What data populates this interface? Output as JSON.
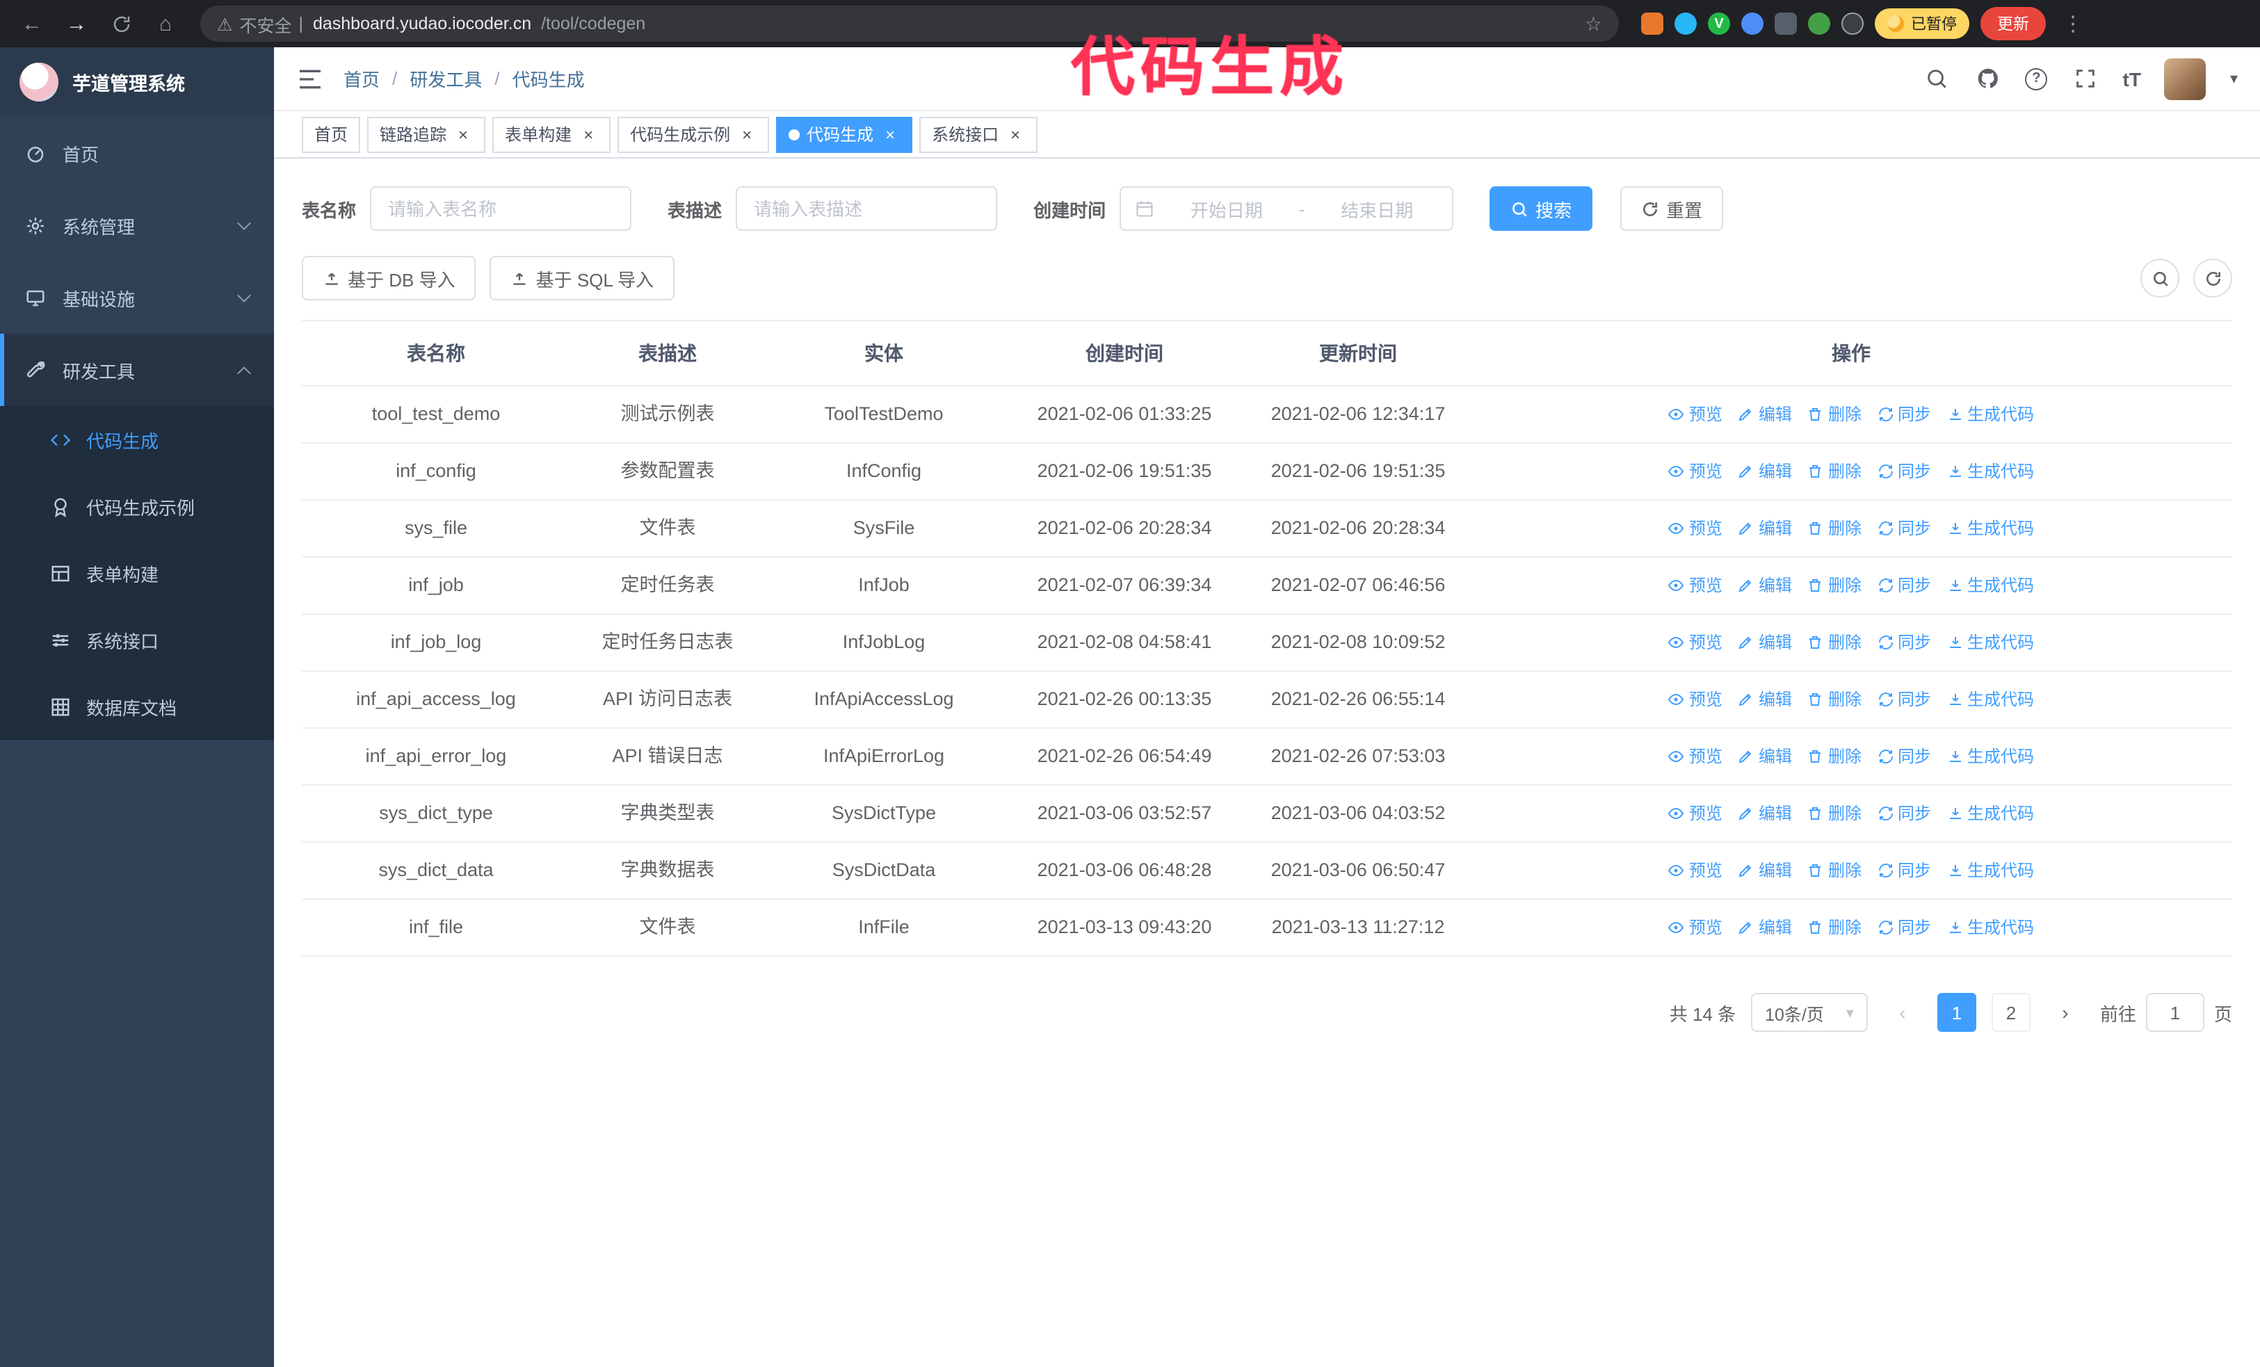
{
  "colors": {
    "primary": "#409eff",
    "sidebar_bg": "#304156",
    "submenu_bg": "#1f2d3d",
    "annotation_red": "#ff3355",
    "update_button_bg": "#e8453c",
    "paused_badge_bg": "#fdd663"
  },
  "icons": {
    "back": "←",
    "forward": "→",
    "home": "⌂",
    "star": "☆",
    "warning": "⚠",
    "divider": "|",
    "menu_dots": "⋮",
    "close": "×",
    "prev": "‹",
    "next": "›",
    "caret": "▾",
    "font_size": "tT",
    "help": "?",
    "check": "V"
  },
  "browser": {
    "security_text": "不安全",
    "url_domain": "dashboard.yudao.iocoder.cn",
    "url_path": "/tool/codegen",
    "paused_badge": "已暂停",
    "update_button": "更新"
  },
  "annotation": {
    "text": "代码生成"
  },
  "sidebar": {
    "logo_title": "芋道管理系统",
    "items": [
      {
        "label": "首页"
      },
      {
        "label": "系统管理"
      },
      {
        "label": "基础设施"
      },
      {
        "label": "研发工具"
      }
    ],
    "submenu": [
      {
        "label": "代码生成"
      },
      {
        "label": "代码生成示例"
      },
      {
        "label": "表单构建"
      },
      {
        "label": "系统接口"
      },
      {
        "label": "数据库文档"
      }
    ]
  },
  "breadcrumb": [
    "首页",
    "研发工具",
    "代码生成"
  ],
  "tabs": [
    {
      "label": "首页"
    },
    {
      "label": "链路追踪"
    },
    {
      "label": "表单构建"
    },
    {
      "label": "代码生成示例"
    },
    {
      "label": "代码生成"
    },
    {
      "label": "系统接口"
    }
  ],
  "search_form": {
    "table_name_label": "表名称",
    "table_name_placeholder": "请输入表名称",
    "table_desc_label": "表描述",
    "table_desc_placeholder": "请输入表描述",
    "create_time_label": "创建时间",
    "start_placeholder": "开始日期",
    "separator": "-",
    "end_placeholder": "结束日期",
    "search_button": "搜索",
    "reset_button": "重置"
  },
  "toolbar": {
    "import_db": "基于 DB 导入",
    "import_sql": "基于 SQL 导入"
  },
  "table": {
    "columns": [
      "表名称",
      "表描述",
      "实体",
      "创建时间",
      "更新时间",
      "操作"
    ],
    "actions": [
      "预览",
      "编辑",
      "删除",
      "同步",
      "生成代码"
    ],
    "rows": [
      {
        "name": "tool_test_demo",
        "desc": "测试示例表",
        "entity": "ToolTestDemo",
        "created": "2021-02-06 01:33:25",
        "updated": "2021-02-06 12:34:17"
      },
      {
        "name": "inf_config",
        "desc": "参数配置表",
        "entity": "InfConfig",
        "created": "2021-02-06 19:51:35",
        "updated": "2021-02-06 19:51:35"
      },
      {
        "name": "sys_file",
        "desc": "文件表",
        "entity": "SysFile",
        "created": "2021-02-06 20:28:34",
        "updated": "2021-02-06 20:28:34"
      },
      {
        "name": "inf_job",
        "desc": "定时任务表",
        "entity": "InfJob",
        "created": "2021-02-07 06:39:34",
        "updated": "2021-02-07 06:46:56"
      },
      {
        "name": "inf_job_log",
        "desc": "定时任务日志表",
        "entity": "InfJobLog",
        "created": "2021-02-08 04:58:41",
        "updated": "2021-02-08 10:09:52"
      },
      {
        "name": "inf_api_access_log",
        "desc": "API 访问日志表",
        "entity": "InfApiAccessLog",
        "created": "2021-02-26 00:13:35",
        "updated": "2021-02-26 06:55:14"
      },
      {
        "name": "inf_api_error_log",
        "desc": "API 错误日志",
        "entity": "InfApiErrorLog",
        "created": "2021-02-26 06:54:49",
        "updated": "2021-02-26 07:53:03"
      },
      {
        "name": "sys_dict_type",
        "desc": "字典类型表",
        "entity": "SysDictType",
        "created": "2021-03-06 03:52:57",
        "updated": "2021-03-06 04:03:52"
      },
      {
        "name": "sys_dict_data",
        "desc": "字典数据表",
        "entity": "SysDictData",
        "created": "2021-03-06 06:48:28",
        "updated": "2021-03-06 06:50:47"
      },
      {
        "name": "inf_file",
        "desc": "文件表",
        "entity": "InfFile",
        "created": "2021-03-13 09:43:20",
        "updated": "2021-03-13 11:27:12"
      }
    ]
  },
  "pagination": {
    "total": "共 14 条",
    "page_size": "10条/页",
    "pages": [
      "1",
      "2"
    ],
    "goto_label": "前往",
    "goto_value": "1",
    "goto_suffix": "页"
  }
}
